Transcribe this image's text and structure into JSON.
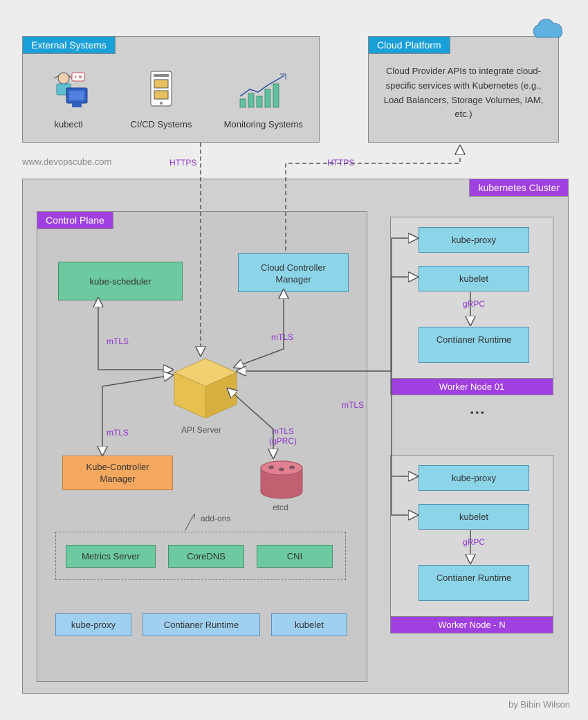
{
  "external": {
    "title": "External Systems",
    "items": [
      "kubectl",
      "CI/CD Systems",
      "Monitoring Systems"
    ]
  },
  "cloud": {
    "title": "Cloud Platform",
    "desc": "Cloud Provider APIs to integrate cloud-specific services with Kubernetes (e.g., Load Balancers, Storage Volumes, IAM, etc.)"
  },
  "site": "www.devopscube.com",
  "protocols": {
    "https1": "HTTPS",
    "https2": "HTTPS"
  },
  "cluster": {
    "title": "kubernetes Cluster",
    "controlPlane": {
      "title": "Control Plane",
      "scheduler": "kube-scheduler",
      "ccm": "Cloud Controller Manager",
      "kcm": "Kube-Controller Manager",
      "apiserver": "API Server",
      "etcd": "etcd",
      "addons": {
        "label": "add-ons",
        "items": [
          "Metrics Server",
          "CoreDNS",
          "CNI"
        ]
      },
      "footer": [
        "kube-proxy",
        "Contianer Runtime",
        "kubelet"
      ],
      "mtls": "mTLS",
      "mtls_grpc": "mTLS (gPRC)"
    },
    "worker1": {
      "title": "Worker Node 01",
      "proxy": "kube-proxy",
      "kubelet": "kubelet",
      "runtime": "Contianer Runtime",
      "grpc": "gRPC"
    },
    "workerN": {
      "title": "Worker Node - N",
      "proxy": "kube-proxy",
      "kubelet": "kubelet",
      "runtime": "Contianer Runtime",
      "grpc": "gRPC"
    }
  },
  "credit": "by Bibin Wilson"
}
